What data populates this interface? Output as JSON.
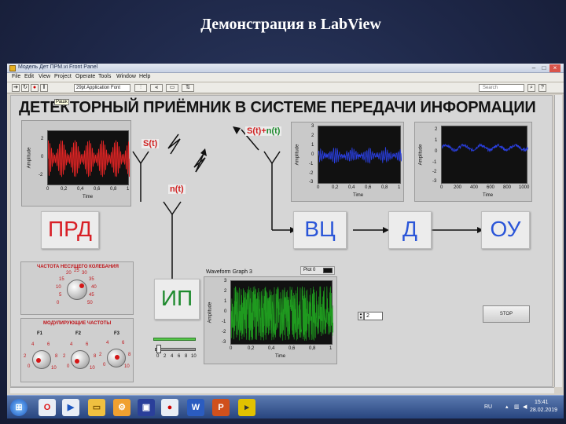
{
  "slide": {
    "title": "Демонстрация в LabView"
  },
  "window": {
    "title": "Модель Дет ПРМ.vi Front Panel"
  },
  "menu": {
    "items": [
      "File",
      "Edit",
      "View",
      "Project",
      "Operate",
      "Tools",
      "Window",
      "Help"
    ]
  },
  "toolbar": {
    "font": "Application Font",
    "font_size": "29pt",
    "search_placeholder": "Search"
  },
  "panel": {
    "heading": "ДЕТЕКТОРНЫЙ ПРИЁМНИК В СИСТЕМЕ ПЕРЕДАЧИ ИНФОРМАЦИИ",
    "tooltip": "Рашк"
  },
  "blocks": {
    "transmitter": "ПРД",
    "input_circuit": "ВЦ",
    "detector": "Д",
    "output_device": "ОУ",
    "noise_source": "ИП"
  },
  "signals": {
    "s": "S(t)",
    "n": "n(t)",
    "sum_s": "S(t)",
    "plus": "+",
    "sum_n": "n(t)"
  },
  "graphs": {
    "common": {
      "ylabel": "Amplitude",
      "xlabel": "Time"
    },
    "g1": {
      "yticks": [
        "2",
        "0",
        "-2"
      ],
      "xticks": [
        "0",
        "0,2",
        "0,4",
        "0,6",
        "0,8",
        "1"
      ]
    },
    "g2": {
      "yticks": [
        "3",
        "2",
        "1",
        "0",
        "-1",
        "-2",
        "-3"
      ],
      "xticks": [
        "0",
        "0,2",
        "0,4",
        "0,6",
        "0,8",
        "1"
      ]
    },
    "g3": {
      "yticks": [
        "2",
        "1",
        "0",
        "-1",
        "-2",
        "-3"
      ],
      "xticks": [
        "0",
        "200",
        "400",
        "600",
        "800",
        "1000"
      ]
    },
    "g4": {
      "title": "Waveform Graph 3",
      "legend": "Plot 0",
      "yticks": [
        "3",
        "2",
        "1",
        "0",
        "-1",
        "-2",
        "-3"
      ],
      "xticks": [
        "0",
        "0,2",
        "0,4",
        "0,6",
        "0,8",
        "1"
      ]
    }
  },
  "carrier_knob": {
    "title": "ЧАСТОТА НЕСУЩЕГО КОЛЕБАНИЯ",
    "ticks": [
      "0",
      "5",
      "10",
      "15",
      "20",
      "25",
      "30",
      "35",
      "40",
      "45",
      "50"
    ]
  },
  "mod_knobs": {
    "title": "МОДУЛИРУЮЩИЕ ЧАСТОТЫ",
    "labels": [
      "F1",
      "F2",
      "F3"
    ],
    "ticks": [
      "0",
      "2",
      "4",
      "6",
      "8",
      "10"
    ]
  },
  "noise_slider": {
    "ticks": [
      "0",
      "2",
      "4",
      "6",
      "8",
      "10"
    ]
  },
  "numeric_control": {
    "value": "2"
  },
  "stop_button": {
    "label": "STOP"
  },
  "taskbar": {
    "lang": "RU",
    "time": "15:41",
    "date": "28.02.2019"
  },
  "colors": {
    "modulated": "#e02424",
    "received": "#2a3fe0",
    "detected": "#2a3fe0",
    "noise": "#1f9a1f",
    "label_red": "#d12121",
    "block_red": "#d81f26",
    "block_blue": "#2a55d8",
    "block_green": "#1e8a2e"
  }
}
